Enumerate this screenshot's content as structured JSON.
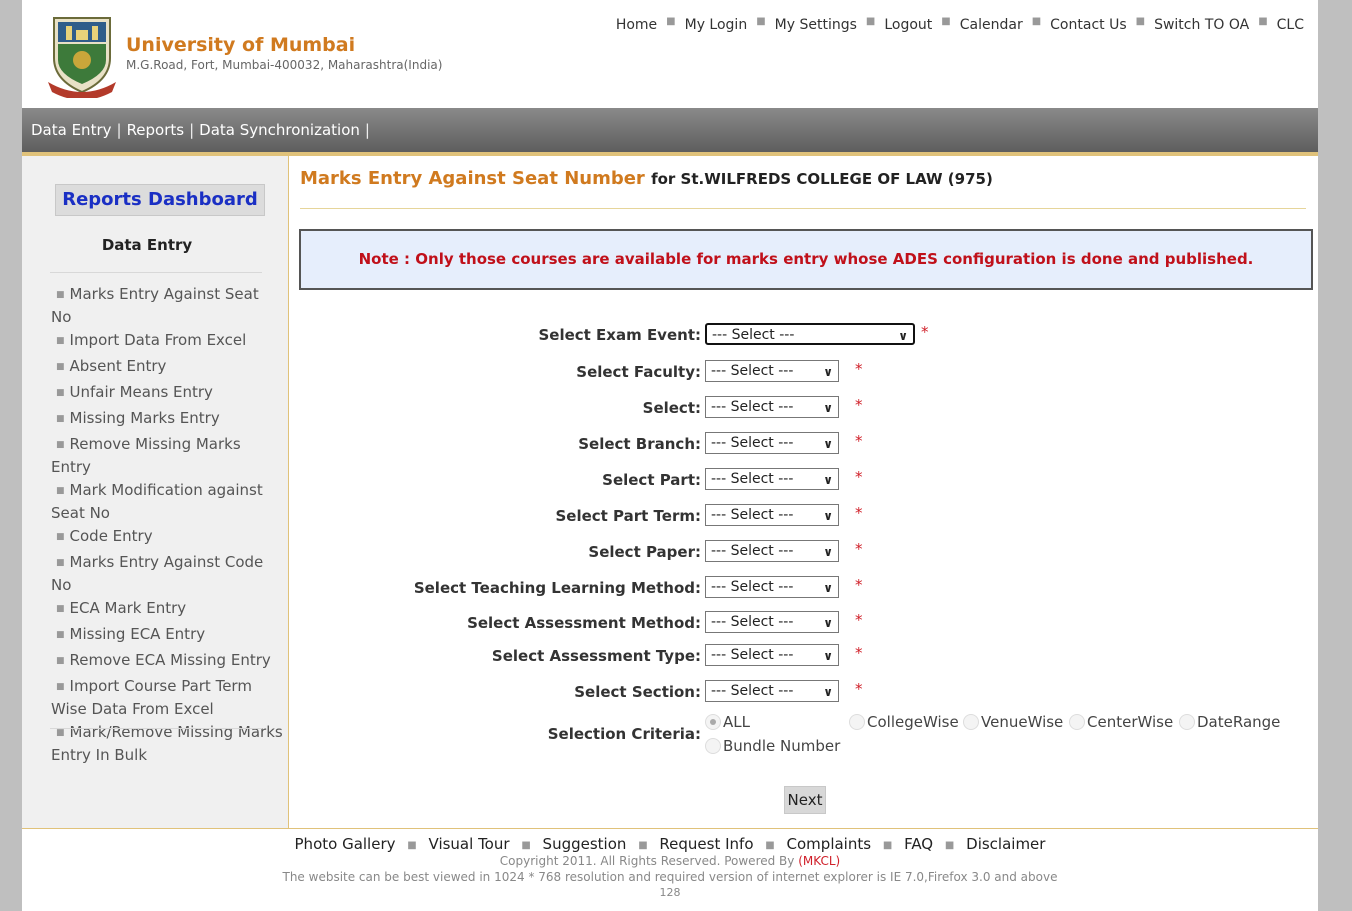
{
  "header": {
    "title": "University of Mumbai",
    "address": "M.G.Road, Fort, Mumbai-400032, Maharashtra(India)",
    "logo_icon": "university-crest-logo",
    "nav": [
      "Home",
      "My Login",
      "My Settings",
      "Logout",
      "Calendar",
      "Contact Us",
      "Switch TO OA",
      "CLC"
    ]
  },
  "menubar": {
    "items": [
      "Data Entry",
      "Reports",
      "Data Synchronization"
    ]
  },
  "sidebar": {
    "dashboard_label": "Reports Dashboard",
    "section_title": "Data Entry",
    "items": [
      "Marks Entry Against Seat No",
      "Import Data From Excel",
      "Absent Entry",
      "Unfair Means Entry",
      "Missing Marks Entry",
      "Remove Missing Marks Entry",
      "Mark Modification against Seat No",
      "Code Entry",
      "Marks Entry Against Code No",
      "ECA Mark Entry",
      "Missing ECA Entry",
      "Remove ECA Missing Entry",
      "Import Course Part Term Wise Data From Excel",
      "Mark/Remove Missing Marks Entry In Bulk"
    ]
  },
  "main": {
    "heading": "Marks Entry Against Seat Number",
    "heading_for": "for St.WILFREDS COLLEGE OF LAW (975)",
    "note": "Note : Only those courses are available for marks entry whose ADES configuration is done and published.",
    "fields": [
      {
        "label": "Select Exam Event",
        "value": "--- Select ---"
      },
      {
        "label": "Select Faculty",
        "value": "--- Select ---"
      },
      {
        "label": "Select",
        "value": "--- Select ---"
      },
      {
        "label": "Select Branch",
        "value": "--- Select ---"
      },
      {
        "label": "Select Part",
        "value": "--- Select ---"
      },
      {
        "label": "Select Part Term",
        "value": "--- Select ---"
      },
      {
        "label": "Select Paper",
        "value": "--- Select ---"
      },
      {
        "label": "Select Teaching Learning Method",
        "value": "--- Select ---"
      },
      {
        "label": "Select Assessment Method",
        "value": "--- Select ---"
      },
      {
        "label": "Select Assessment Type",
        "value": "--- Select ---"
      },
      {
        "label": "Select Section",
        "value": "--- Select ---"
      }
    ],
    "required_mark": "*",
    "criteria_label": "Selection Criteria",
    "criteria_options": [
      "ALL",
      "CollegeWise",
      "VenueWise",
      "CenterWise",
      "DateRange",
      "Bundle Number"
    ],
    "criteria_selected": "ALL",
    "next_label": "Next"
  },
  "footer": {
    "links": [
      "Photo Gallery",
      "Visual Tour",
      "Suggestion",
      "Request Info",
      "Complaints",
      "FAQ",
      "Disclaimer"
    ],
    "copyright": "Copyright 2011. All Rights Reserved. Powered By",
    "powered_by": "(MKCL)",
    "best_viewed": "The website can be best viewed in 1024 * 768 resolution and required version of internet explorer is IE 7.0,Firefox 3.0 and above",
    "counter": "128"
  },
  "colors": {
    "accent_orange": "#d07a1f",
    "note_red": "#c0101a",
    "dashboard_blue": "#1a2fc4",
    "required_red": "#d0202a"
  }
}
